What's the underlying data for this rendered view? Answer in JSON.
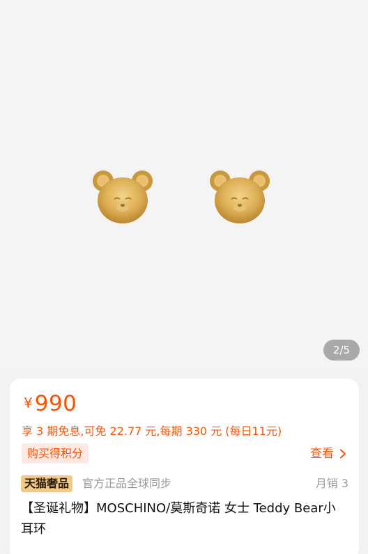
{
  "gallery": {
    "image_alt": "MOSCHINO Teddy Bear earrings",
    "page_indicator": "2/5"
  },
  "price": {
    "currency": "¥",
    "amount": "990"
  },
  "installment_text": "享 3 期免息,可免 22.77 元,每期 330 元 (每日11元)",
  "points_badge": "购买得积分",
  "view_link": "查看",
  "brand_row": {
    "badge": "天猫奢品",
    "description": "官方正品全球同步",
    "monthly_sales": "月销 3"
  },
  "product_title": "【圣诞礼物】MOSCHINO/莫斯奇诺  女士 Teddy Bear小耳环",
  "colors": {
    "accent": "#ff5000",
    "badge_bg": "#fde9e3",
    "tmall_badge_bg": "#f2c987"
  }
}
